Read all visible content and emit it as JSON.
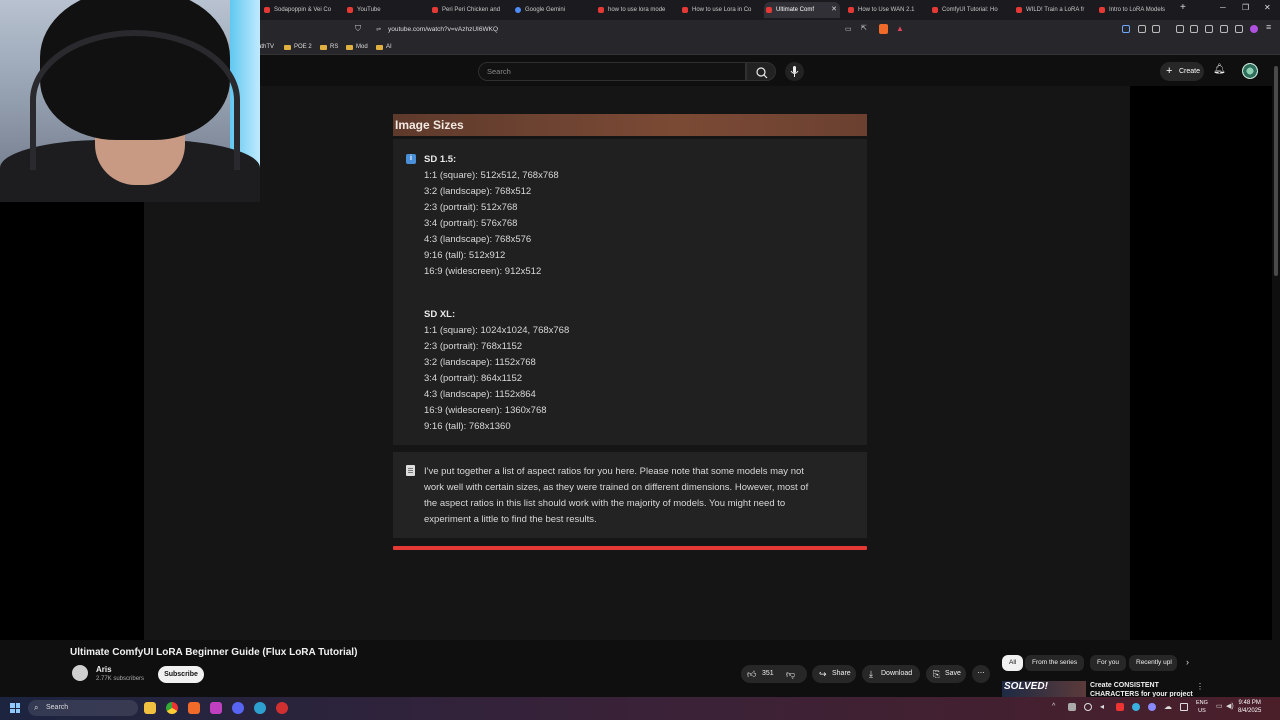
{
  "browser": {
    "tabs": [
      {
        "label": "Sodapoppin & Vei Co"
      },
      {
        "label": "YouTube"
      },
      {
        "label": "Peri Peri Chicken and"
      },
      {
        "label": "Google Gemini"
      },
      {
        "label": "how to use lora mode"
      },
      {
        "label": "How to use Lora in Co"
      },
      {
        "label": "Ultimate Comf"
      },
      {
        "label": "How to Use WAN 2.1"
      },
      {
        "label": "ComfyUI Tutorial: Ho"
      },
      {
        "label": "WILD! Train a LoRA fr"
      },
      {
        "label": "Intro to LoRA Models"
      }
    ],
    "url": "youtube.com/watch?v=vAzhzUI6WKQ",
    "bookmarks": [
      "athTV",
      "POE 2",
      "RS",
      "Mod",
      "AI"
    ]
  },
  "youtube": {
    "search_placeholder": "Search",
    "create_label": "Create"
  },
  "document": {
    "section_title": "Image Sizes",
    "sd15": {
      "label": "SD 1.5:",
      "lines": [
        "1:1 (square): 512x512, 768x768",
        "3:2 (landscape): 768x512",
        "2:3 (portrait): 512x768",
        "3:4 (portrait): 576x768",
        "4:3 (landscape): 768x576",
        "9:16 (tall): 512x912",
        "16:9 (widescreen): 912x512"
      ]
    },
    "sdxl": {
      "label": "SD XL:",
      "lines": [
        "1:1 (square): 1024x1024, 768x768",
        "2:3 (portrait): 768x1152",
        "3:2 (landscape): 1152x768",
        "3:4 (portrait): 864x1152",
        "4:3 (landscape): 1152x864",
        "16:9 (widescreen): 1360x768",
        "9:16 (tall): 768x1360"
      ]
    },
    "note_lines": [
      "I've put together a list of aspect ratios for you here. Please note that some models may not",
      "work well with certain sizes, as they were trained on different dimensions. However, most of",
      "the aspect ratios in this list should work with the majority of models. You might need to",
      "experiment a little to find the best results."
    ]
  },
  "video": {
    "title": "Ultimate ComfyUI LoRA Beginner Guide (Flux LoRA Tutorial)",
    "channel": "Aris",
    "subscribers": "2.77K subscribers",
    "subscribe_label": "Subscribe",
    "likes": "351",
    "share_label": "Share",
    "download_label": "Download",
    "save_label": "Save"
  },
  "recommendations": {
    "chips": [
      "All",
      "From the series",
      "For you",
      "Recently upl"
    ],
    "thumb_text": "SOLVED!",
    "first_title_line1": "Create CONSISTENT",
    "first_title_line2": "CHARACTERS for your project"
  },
  "taskbar": {
    "search_label": "Search",
    "lang_line1": "ENG",
    "lang_line2": "US",
    "time": "9:48 PM",
    "date": "8/4/2025"
  }
}
